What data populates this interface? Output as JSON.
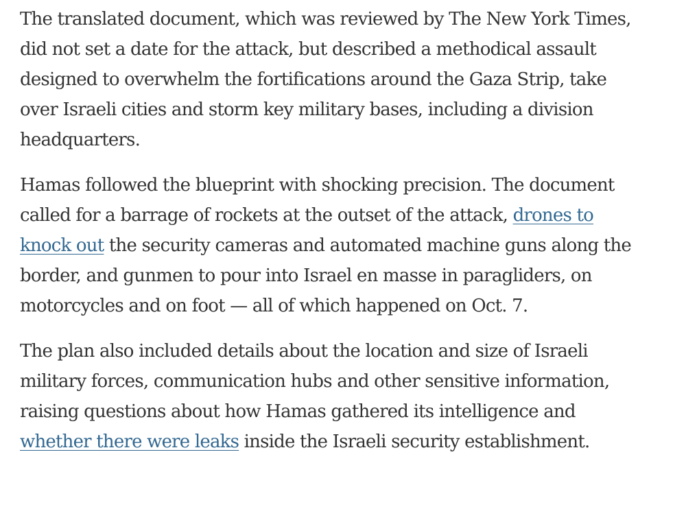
{
  "article": {
    "paragraphs": [
      {
        "text_before": "The translated document, which was reviewed by The New York Times, did not set a date for the attack, but described a methodical assault designed to overwhelm the fortifications around the Gaza Strip, take over Israeli cities and storm key military bases, including a division headquarters."
      },
      {
        "text_before": "Hamas followed the blueprint with shocking precision. The document called for a barrage of rockets at the outset of the attack, ",
        "link_text": "drones to knock out",
        "text_after": " the security cameras and automated machine guns along the border, and gunmen to pour into Israel en masse in paragliders, on motorcycles and on foot — all of which happened on Oct. 7."
      },
      {
        "text_before": "The plan also included details about the location and size of Israeli military forces, communication hubs and other sensitive information, raising questions about how Hamas gathered its intelligence and ",
        "link_text": "whether there were leaks",
        "text_after": " inside the Israeli security establishment."
      }
    ]
  },
  "colors": {
    "body_text": "#333333",
    "link": "#326891",
    "background": "#ffffff"
  }
}
